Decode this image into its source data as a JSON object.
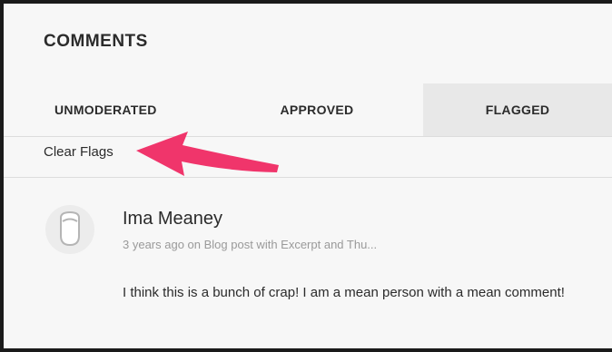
{
  "header": {
    "title": "COMMENTS"
  },
  "tabs": [
    {
      "label": "UNMODERATED",
      "active": false
    },
    {
      "label": "APPROVED",
      "active": false
    },
    {
      "label": "FLAGGED",
      "active": true
    }
  ],
  "actions": {
    "clear_flags": "Clear Flags"
  },
  "comment": {
    "avatar_icon": "user-silhouette-icon",
    "author": "Ima Meaney",
    "meta": "3 years ago on Blog post with Excerpt and Thu...",
    "text": "I think this is a bunch of crap! I am a mean person with a mean comment!"
  },
  "annotation": {
    "icon": "pointer-arrow",
    "color": "#f0356b"
  }
}
